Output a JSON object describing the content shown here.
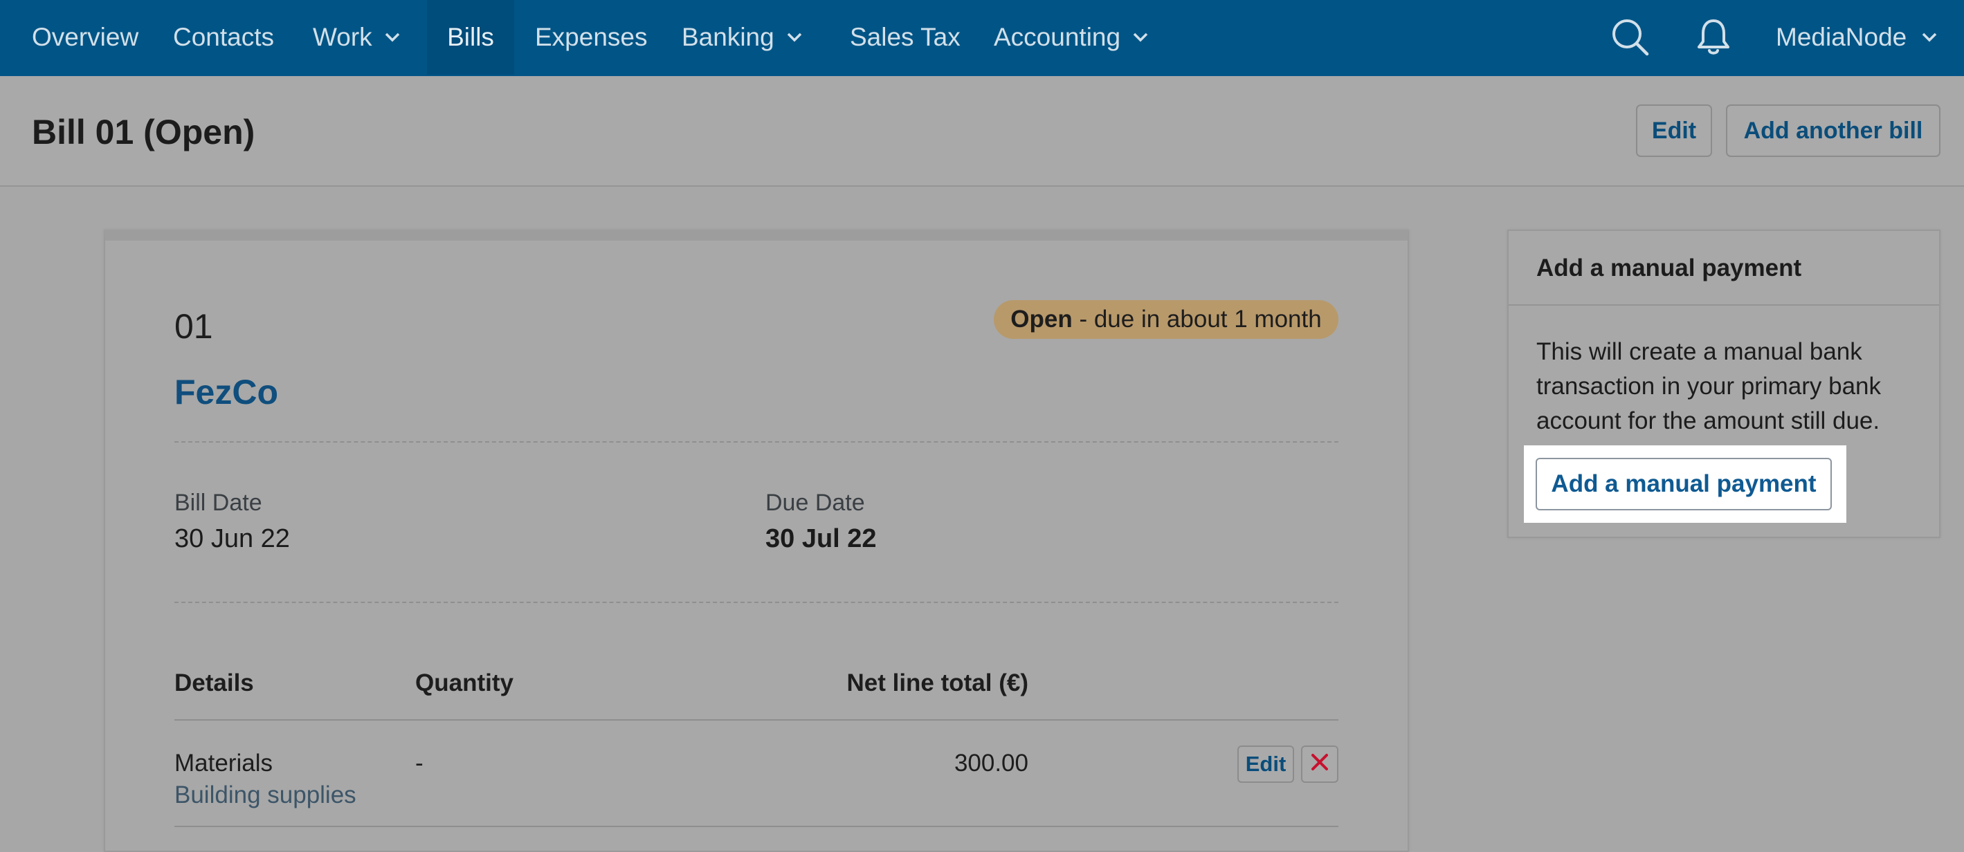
{
  "nav": {
    "items": [
      {
        "label": "Overview",
        "has_dropdown": false,
        "active": false
      },
      {
        "label": "Contacts",
        "has_dropdown": false,
        "active": false
      },
      {
        "label": "Work",
        "has_dropdown": true,
        "active": false
      },
      {
        "label": "Bills",
        "has_dropdown": false,
        "active": true
      },
      {
        "label": "Expenses",
        "has_dropdown": false,
        "active": false
      },
      {
        "label": "Banking",
        "has_dropdown": true,
        "active": false
      },
      {
        "label": "Sales Tax",
        "has_dropdown": false,
        "active": false
      },
      {
        "label": "Accounting",
        "has_dropdown": true,
        "active": false
      }
    ],
    "search_icon": "search-icon",
    "notifications_icon": "bell-icon",
    "company": "MediaNode"
  },
  "header": {
    "title": "Bill 01 (Open)",
    "edit_label": "Edit",
    "add_another_label": "Add another bill"
  },
  "bill": {
    "number": "01",
    "contact": "FezCo",
    "status_word": "Open",
    "status_detail": " - due in about 1 month",
    "bill_date_label": "Bill Date",
    "bill_date": "30 Jun 22",
    "due_date_label": "Due Date",
    "due_date": "30 Jul 22",
    "table": {
      "headers": [
        "Details",
        "Quantity",
        "Net line total (€)"
      ],
      "rows": [
        {
          "details": "Materials",
          "description": "Building supplies",
          "quantity": "-",
          "net_total": "300.00",
          "edit_label": "Edit"
        }
      ]
    }
  },
  "payment_panel": {
    "title": "Add a manual payment",
    "text": "This will create a manual bank transaction in your primary bank account for the amount still due.",
    "button_label": "Add a manual payment"
  },
  "colors": {
    "nav_background": "#015586",
    "status_badge": "#b8996a",
    "link_blue": "#0f5a92",
    "delete_red": "#c8102e"
  }
}
